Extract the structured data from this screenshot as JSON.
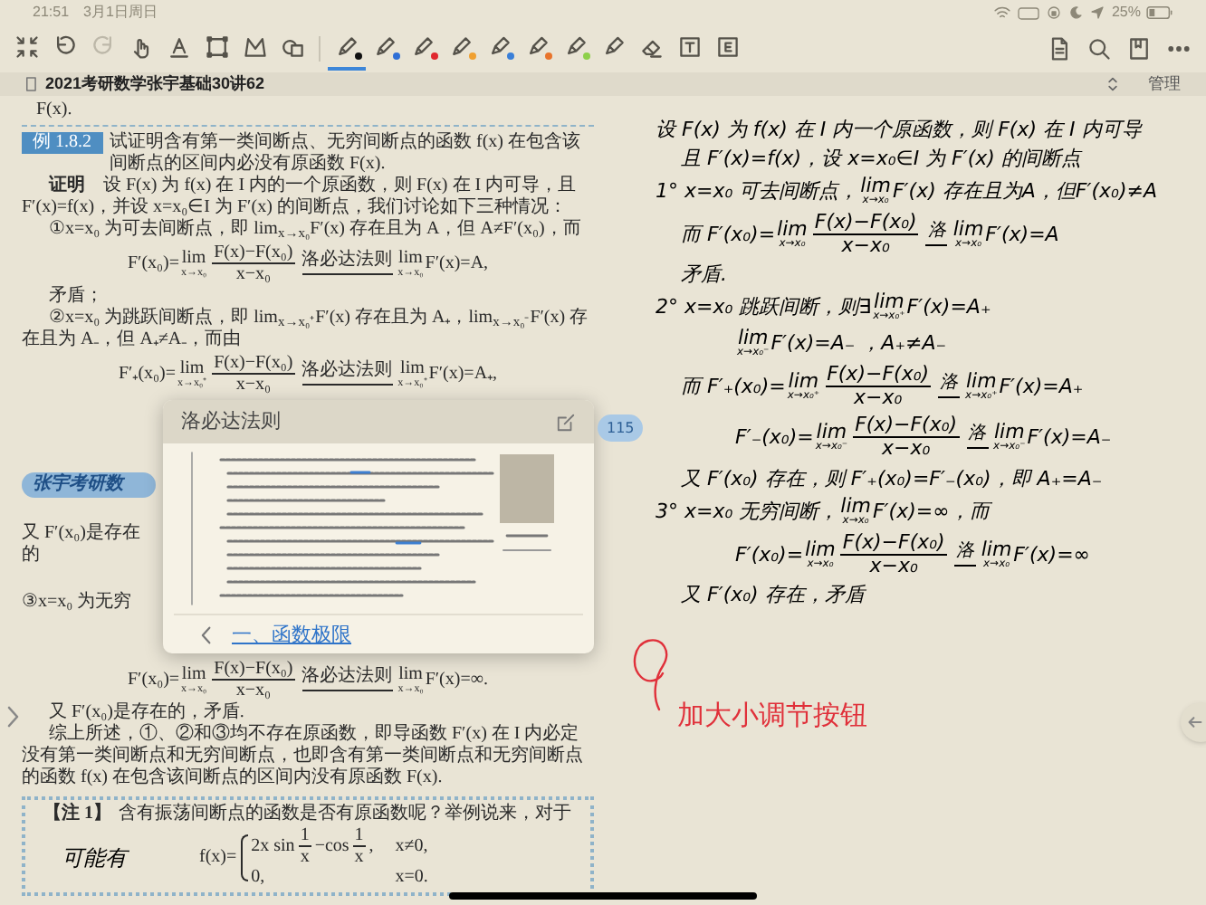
{
  "status_bar": {
    "time": "21:51",
    "date": "3月1日周日",
    "battery": "25%"
  },
  "toolbar": {
    "tools": [
      {
        "kind": "collapse",
        "selected": false,
        "disabled": false
      },
      {
        "kind": "undo",
        "selected": false,
        "disabled": false
      },
      {
        "kind": "redo",
        "selected": false,
        "disabled": true
      },
      {
        "kind": "hand",
        "selected": false,
        "disabled": false
      },
      {
        "kind": "text-style",
        "selected": false,
        "disabled": false
      },
      {
        "kind": "rect-select",
        "selected": false,
        "disabled": false
      },
      {
        "kind": "lasso",
        "selected": false,
        "disabled": false
      },
      {
        "kind": "shapes",
        "selected": false,
        "disabled": false
      },
      {
        "kind": "pen",
        "selected": true,
        "disabled": false,
        "color": "#111111"
      },
      {
        "kind": "pen",
        "selected": false,
        "disabled": false,
        "color": "#2f6fd6"
      },
      {
        "kind": "pen",
        "selected": false,
        "disabled": false,
        "color": "#e0282e"
      },
      {
        "kind": "pen",
        "selected": false,
        "disabled": false,
        "color": "#f0a030"
      },
      {
        "kind": "marker",
        "selected": false,
        "disabled": false,
        "color": "#3a7fd8"
      },
      {
        "kind": "marker",
        "selected": false,
        "disabled": false,
        "color": "#e8742c"
      },
      {
        "kind": "marker",
        "selected": false,
        "disabled": false,
        "color": "#8ed04a"
      },
      {
        "kind": "marker",
        "selected": false,
        "disabled": false
      },
      {
        "kind": "eraser",
        "selected": false,
        "disabled": false
      },
      {
        "kind": "textbox",
        "selected": false,
        "disabled": false
      },
      {
        "kind": "extract",
        "selected": false,
        "disabled": false
      }
    ],
    "right_tools": [
      {
        "kind": "document"
      },
      {
        "kind": "search"
      },
      {
        "kind": "bookmark"
      },
      {
        "kind": "more"
      }
    ]
  },
  "document": {
    "title": "2021考研数学张宇基础30讲62",
    "manage": "管理"
  },
  "book": {
    "continued": "F(x).",
    "example": {
      "badge": "例 1.8.2",
      "text": "试证明含有第一类间断点、无穷间断点的函数 f(x) 在包含该间断点的区间内必没有原函数 F(x)."
    },
    "top_blocks": [
      {
        "kind": "para",
        "text": "**证明**　设 F(x) 为 f(x) 在 I 内的一个原函数，则 F(x) 在 I 内可导，且 F′(x)=f(x)，并设 x=x₀∈I 为 F′(x) 的间断点，我们讨论如下三种情况："
      },
      {
        "kind": "para",
        "text": "①x=x₀ 为可去间断点，即 lim$_{x→x₀}$F′(x) 存在且为 A，但 A≠F′(x₀)，而"
      },
      {
        "kind": "formula",
        "parts": [
          {
            "kind": "t",
            "text": "F′(x₀)="
          },
          {
            "kind": "lim",
            "text": "lim",
            "sub": "x→x₀"
          },
          {
            "kind": "frac",
            "num": "F(x)−F(x₀)",
            "den": "x−x₀"
          },
          {
            "kind": "arrow",
            "text": "洛必达法则"
          },
          {
            "kind": "lim",
            "text": "lim",
            "sub": "x→x₀"
          },
          {
            "kind": "t",
            "text": "F′(x)=A,"
          }
        ]
      },
      {
        "kind": "para",
        "text": "矛盾；"
      },
      {
        "kind": "para",
        "text": "②x=x₀ 为跳跃间断点，即 lim$_{x→x₀⁺}$F′(x) 存在且为 A₊，lim$_{x→x₀⁻}$F′(x) 存在且为 A₋，但 A₊≠A₋，而由"
      },
      {
        "kind": "formula",
        "parts": [
          {
            "kind": "t",
            "text": "F′₊(x₀)="
          },
          {
            "kind": "lim",
            "text": "lim",
            "sub": "x→x₀⁺"
          },
          {
            "kind": "frac",
            "num": "F(x)−F(x₀)",
            "den": "x−x₀"
          },
          {
            "kind": "arrow",
            "text": "洛必达法则"
          },
          {
            "kind": "lim",
            "text": "lim",
            "sub": "x→x₀⁺"
          },
          {
            "kind": "t",
            "text": "F′(x)=A₊,"
          }
        ]
      }
    ],
    "logo": "张宇考研数",
    "under_popup": [
      "又 F′(x₀)是存在的",
      "③x=x₀ 为无穷"
    ],
    "bottom_blocks": [
      {
        "kind": "formula",
        "parts": [
          {
            "kind": "t",
            "text": "F′(x₀)="
          },
          {
            "kind": "lim",
            "text": "lim",
            "sub": "x→x₀"
          },
          {
            "kind": "frac",
            "num": "F(x)−F(x₀)",
            "den": "x−x₀"
          },
          {
            "kind": "arrow",
            "text": "洛必达法则"
          },
          {
            "kind": "lim",
            "text": "lim",
            "sub": "x→x₀"
          },
          {
            "kind": "t",
            "text": "F′(x)=∞."
          }
        ]
      },
      {
        "kind": "para",
        "text": "又 F′(x₀)是存在的，矛盾."
      },
      {
        "kind": "para",
        "text": "综上所述，①、②和③均不存在原函数，即导函数 F′(x) 在 I 内必定没有第一类间断点和无穷间断点，也即含有第一类间断点和无穷间断点的函数 f(x) 在包含该间断点的区间内没有原函数 F(x)."
      }
    ],
    "note": {
      "label": "【注 1】",
      "text": "含有振荡间断点的函数是否有原函数呢？举例说来，对于",
      "handwritten": "可能有",
      "lhs": "f(x)=",
      "rows": [
        {
          "parts": [
            {
              "kind": "t",
              "text": "2x sin"
            },
            {
              "kind": "frac",
              "num": "1",
              "den": "x"
            },
            {
              "kind": "t",
              "text": "−cos"
            },
            {
              "kind": "frac",
              "num": "1",
              "den": "x"
            },
            {
              "kind": "t",
              "text": ","
            }
          ],
          "condition": "x≠0,"
        },
        {
          "parts": [
            {
              "kind": "t",
              "text": "0,"
            }
          ],
          "condition": "x=0."
        }
      ]
    },
    "page_number": "115"
  },
  "popover": {
    "title": "洛必达法则",
    "back_link": "一、函数极限"
  },
  "notes": {
    "lines": [
      {
        "kind": "main",
        "parts": [
          {
            "kind": "t",
            "text": "设 F(x) 为 f(x) 在 I 内一个原函数，则 F(x) 在 I 内可导"
          }
        ]
      },
      {
        "kind": "continued",
        "parts": [
          {
            "kind": "t",
            "text": "且 F′(x)=f(x)，设 x=x₀∈I 为 F′(x) 的间断点"
          }
        ]
      },
      {
        "kind": "main",
        "parts": [
          {
            "kind": "t",
            "text": "1° x=x₀ 可去间断点，"
          },
          {
            "kind": "lim",
            "text": "lim",
            "sub": "x→x₀"
          },
          {
            "kind": "t",
            "text": "F′(x) 存在且为A，但F′(x₀)≠A"
          }
        ]
      },
      {
        "kind": "continued",
        "parts": [
          {
            "kind": "t",
            "text": "而 F′(x₀)="
          },
          {
            "kind": "lim",
            "text": "lim",
            "sub": "x→x₀"
          },
          {
            "kind": "frac",
            "num": "F(x)−F(x₀)",
            "den": "x−x₀"
          },
          {
            "kind": "arrow",
            "text": "洛"
          },
          {
            "kind": "lim",
            "text": "lim",
            "sub": "x→x₀"
          },
          {
            "kind": "t",
            "text": "F′(x)=A"
          }
        ]
      },
      {
        "kind": "continued",
        "parts": [
          {
            "kind": "t",
            "text": "矛盾."
          }
        ]
      },
      {
        "kind": "main",
        "parts": [
          {
            "kind": "t",
            "text": "2° x=x₀ 跳跃间断，则∃"
          },
          {
            "kind": "lim",
            "text": "lim",
            "sub": "x→x₀⁺"
          },
          {
            "kind": "t",
            "text": "F′(x)=A₊"
          }
        ]
      },
      {
        "kind": "indented",
        "parts": [
          {
            "kind": "lim",
            "text": "lim",
            "sub": "x→x₀⁻"
          },
          {
            "kind": "t",
            "text": "F′(x)=A₋ ，A₊≠A₋"
          }
        ]
      },
      {
        "kind": "continued",
        "parts": [
          {
            "kind": "t",
            "text": "而 F′₊(x₀)="
          },
          {
            "kind": "lim",
            "text": "lim",
            "sub": "x→x₀⁺"
          },
          {
            "kind": "frac",
            "num": "F(x)−F(x₀)",
            "den": "x−x₀"
          },
          {
            "kind": "arrow",
            "text": "洛"
          },
          {
            "kind": "lim",
            "text": "lim",
            "sub": "x→x₀⁺"
          },
          {
            "kind": "t",
            "text": "F′(x)=A₊"
          }
        ]
      },
      {
        "kind": "indented",
        "parts": [
          {
            "kind": "t",
            "text": "F′₋(x₀)="
          },
          {
            "kind": "lim",
            "text": "lim",
            "sub": "x→x₀⁻"
          },
          {
            "kind": "frac",
            "num": "F(x)−F(x₀)",
            "den": "x−x₀"
          },
          {
            "kind": "arrow",
            "text": "洛"
          },
          {
            "kind": "lim",
            "text": "lim",
            "sub": "x→x₀⁻"
          },
          {
            "kind": "t",
            "text": "F′(x)=A₋"
          }
        ]
      },
      {
        "kind": "continued",
        "parts": [
          {
            "kind": "t",
            "text": "又 F′(x₀) 存在，则 F′₊(x₀)=F′₋(x₀)，即 A₊=A₋"
          }
        ]
      },
      {
        "kind": "main",
        "parts": [
          {
            "kind": "t",
            "text": "3° x=x₀ 无穷间断，"
          },
          {
            "kind": "lim",
            "text": "lim",
            "sub": "x→x₀"
          },
          {
            "kind": "t",
            "text": "F′(x)=∞，而"
          }
        ]
      },
      {
        "kind": "indented",
        "parts": [
          {
            "kind": "t",
            "text": "F′(x₀)="
          },
          {
            "kind": "lim",
            "text": "lim",
            "sub": "x→x₀"
          },
          {
            "kind": "frac",
            "num": "F(x)−F(x₀)",
            "den": "x−x₀"
          },
          {
            "kind": "arrow",
            "text": "洛"
          },
          {
            "kind": "lim",
            "text": "lim",
            "sub": "x→x₀"
          },
          {
            "kind": "t",
            "text": "F′(x)=∞"
          }
        ]
      },
      {
        "kind": "continued",
        "parts": [
          {
            "kind": "t",
            "text": "又 F′(x₀) 存在，矛盾"
          }
        ]
      }
    ],
    "annotation": "加大小调节按钮"
  }
}
